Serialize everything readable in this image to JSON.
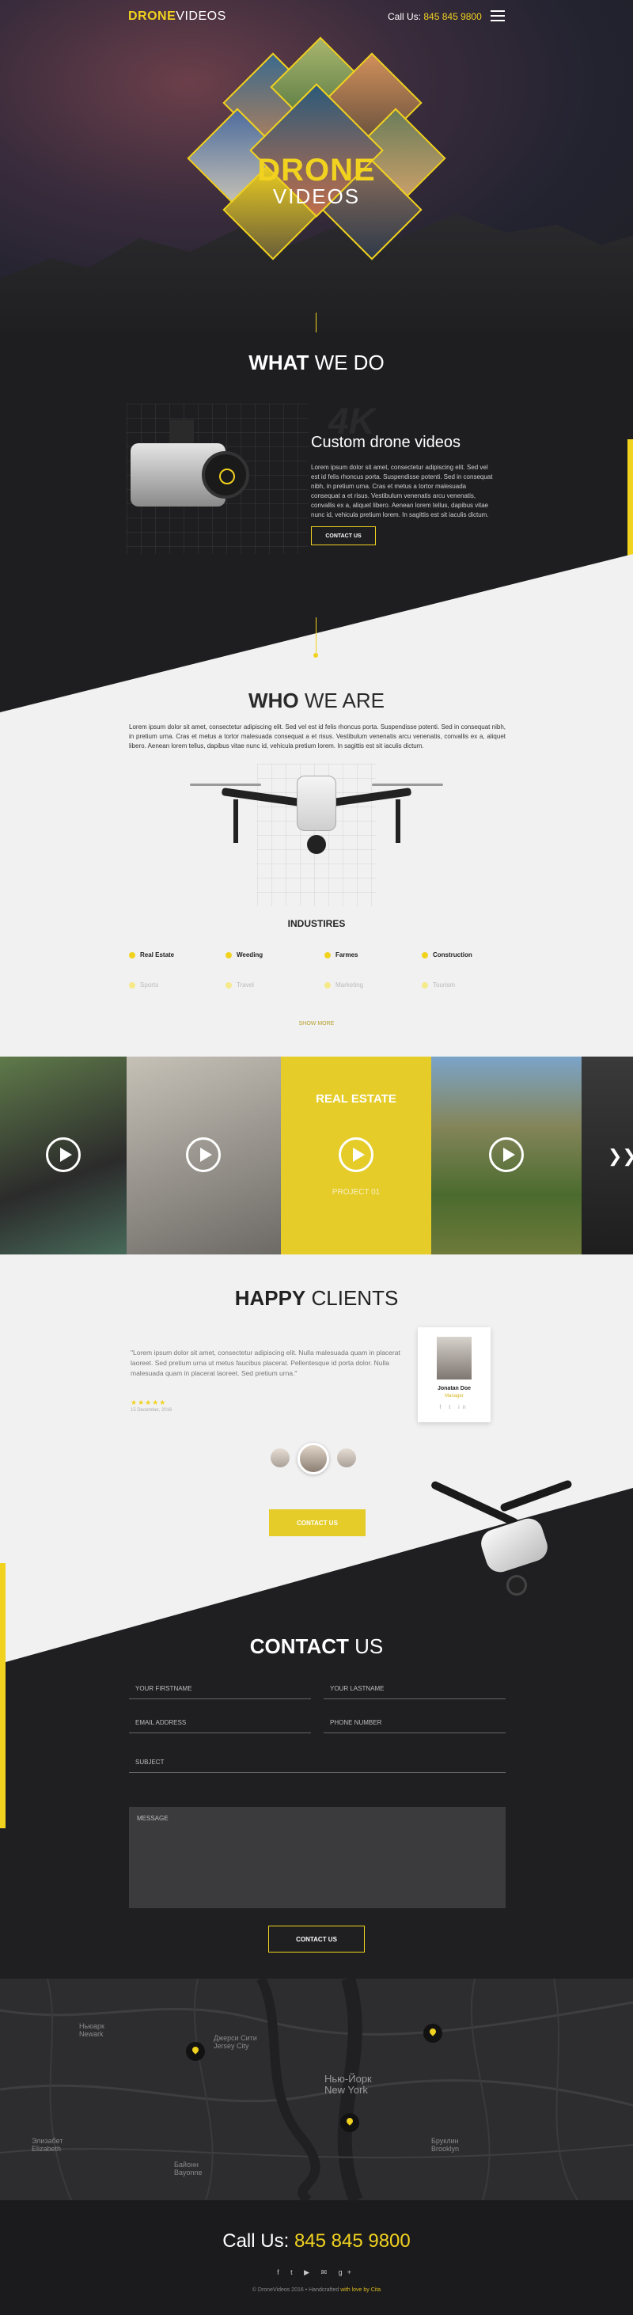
{
  "header": {
    "logo_bold": "DRONE",
    "logo_light": "VIDEOS",
    "call_label": "Call Us:",
    "call_number": "845 845 9800",
    "menu_icon": "hamburger-menu-icon"
  },
  "hero": {
    "title_line1": "DRONE",
    "title_line2": "VIDEOS"
  },
  "what": {
    "title_bold": "WHAT",
    "title_light": "WE DO",
    "badge": "4K",
    "subtitle": "Custom drone videos",
    "text": "Lorem ipsum dolor sit amet, consectetur adipiscing elit. Sed vel est id felis rhoncus porta. Suspendisse potenti. Sed in consequat nibh, in pretium urna. Cras et metus a tortor malesuada consequat a et risus. Vestibulum venenatis arcu venenatis, convallis ex a, aliquet libero. Aenean lorem tellus, dapibus vitae nunc id, vehicula pretium lorem. In sagittis est sit iaculis dictum.",
    "button": "CONTACT US"
  },
  "who": {
    "title_bold": "WHO",
    "title_light": "WE ARE",
    "text": "Lorem ipsum dolor sit amet, consectetur adipiscing elit. Sed vel est id felis rhoncus porta. Suspendisse potenti. Sed in consequat nibh, in pretium urna. Cras et metus a tortor malesuada consequat a et risus. Vestibulum venenatis arcu venenatis, convallis ex a, aliquet libero. Aenean lorem tellus, dapibus vitae nunc id, vehicula pretium lorem. In sagittis est sit iaculis dictum.",
    "industries_title": "INDUSTIRES",
    "industries": [
      "Real Estate",
      "Weeding",
      "Farmes",
      "Construction"
    ],
    "industries_faded": [
      "Sports",
      "Travel",
      "Marketing",
      "Tourism"
    ],
    "show_more": "SHOW MORE"
  },
  "videos": {
    "real_estate_label": "REAL ESTATE",
    "real_estate_sub": "PROJECT 01",
    "next_icon": "chevron-right-icon"
  },
  "clients": {
    "title_bold": "HAPPY",
    "title_light": "CLIENTS",
    "quote": "\"Lorem ipsum dolor sit amet, consectetur adipiscing elit. Nulla malesuada quam in placerat laoreet. Sed pretium urna ut metus faucibus placerat. Pellentesque id porta dolor. Nulla malesuada quam in placerat laoreet. Sed pretium urna.\"",
    "stars": "★★★★★",
    "date": "15 December, 2016",
    "name": "Jonatan Doe",
    "role": "Manager",
    "socials": "f t in",
    "button": "CONTACT US"
  },
  "contact": {
    "title_bold": "CONTACT",
    "title_light": "US",
    "firstname": "YOUR FIRSTNAME",
    "lastname": "YOUR LASTNAME",
    "email": "EMAIL ADDRESS",
    "phone": "PHONE NUMBER",
    "subject": "SUBJECT",
    "message": "MESSAGE",
    "button": "CONTACT US"
  },
  "map": {
    "labels": [
      "Ньюарк\nNewark",
      "Джерси Сити\nJersey City",
      "Нью-Йорк\nNew York",
      "Элизабет\nElizabeth",
      "Бруклин\nBrooklyn",
      "Байонн\nBayonne"
    ]
  },
  "footer": {
    "call_label": "Call Us:",
    "call_number": "845 845 9800",
    "socials": "f t ▶ ✉ g+",
    "copy_left": "© DroneVideos 2016",
    "copy_sep": "•",
    "copy_mid": "Handcrafted",
    "copy_right": "with love by Cita"
  }
}
